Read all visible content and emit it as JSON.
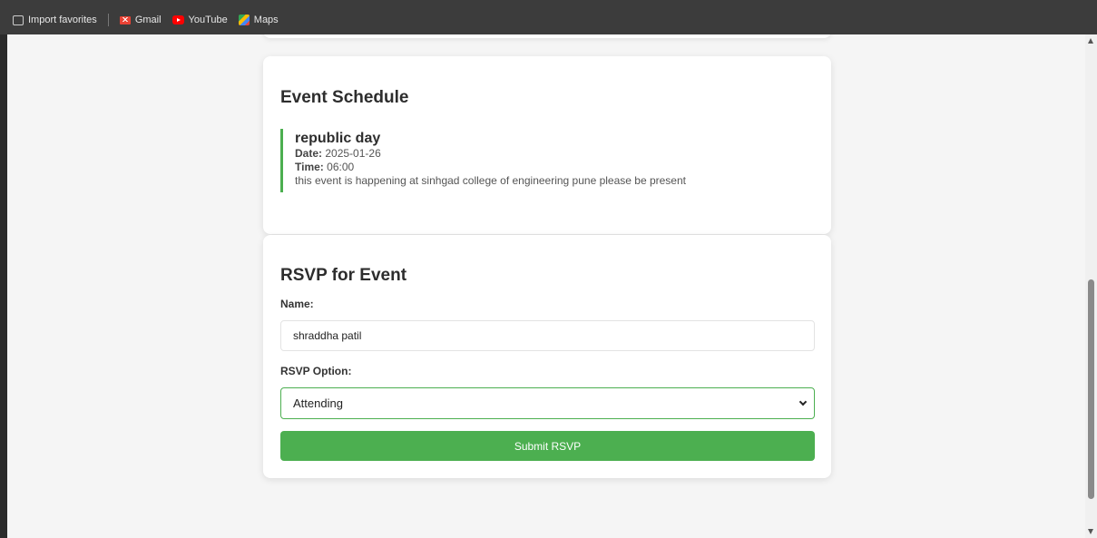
{
  "bookmarks": [
    {
      "label": "Import favorites",
      "icon": "import-icon"
    },
    {
      "label": "Gmail",
      "icon": "gmail-icon"
    },
    {
      "label": "YouTube",
      "icon": "youtube-icon"
    },
    {
      "label": "Maps",
      "icon": "maps-icon"
    }
  ],
  "schedule": {
    "heading": "Event Schedule",
    "event": {
      "title": "republic day",
      "date_label": "Date:",
      "date": "2025-01-26",
      "time_label": "Time:",
      "time": "06:00",
      "description": "this event is happening at sinhgad college of engineering pune please be present"
    }
  },
  "rsvp": {
    "heading": "RSVP for Event",
    "name_label": "Name:",
    "name_value": "shraddha patil",
    "option_label": "RSVP Option:",
    "option_selected": "Attending",
    "submit_label": "Submit RSVP"
  },
  "colors": {
    "accent": "#4caf50",
    "page_bg": "#f5f5f5",
    "card_bg": "#ffffff"
  }
}
